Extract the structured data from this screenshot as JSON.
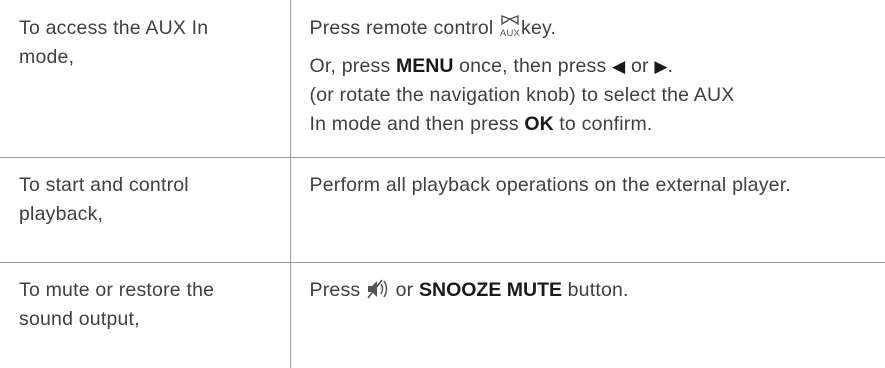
{
  "rows": [
    {
      "action": "To access the AUX In mode,",
      "step1": {
        "before": "Press remote control",
        "icon": "aux-key-icon",
        "icon_label": "AUX",
        "after": "key."
      },
      "step2": {
        "t1": "Or, press",
        "b1": "MENU",
        "t2": "once, then press",
        "left_icon": "◀",
        "t3": "or",
        "right_icon": "▶",
        "t4": ".",
        "line2": "(or rotate the navigation knob) to select the AUX",
        "t5": "In mode and then press",
        "b2": "OK",
        "t6": "to confirm."
      }
    },
    {
      "action": "To start and control playback,",
      "instruction": "Perform all playback operations on the external player."
    },
    {
      "action": "To mute or restore the sound output,",
      "t1": "Press",
      "icon": "mute-icon",
      "t2": "or",
      "b1": "SNOOZE MUTE",
      "t3": "button."
    }
  ]
}
